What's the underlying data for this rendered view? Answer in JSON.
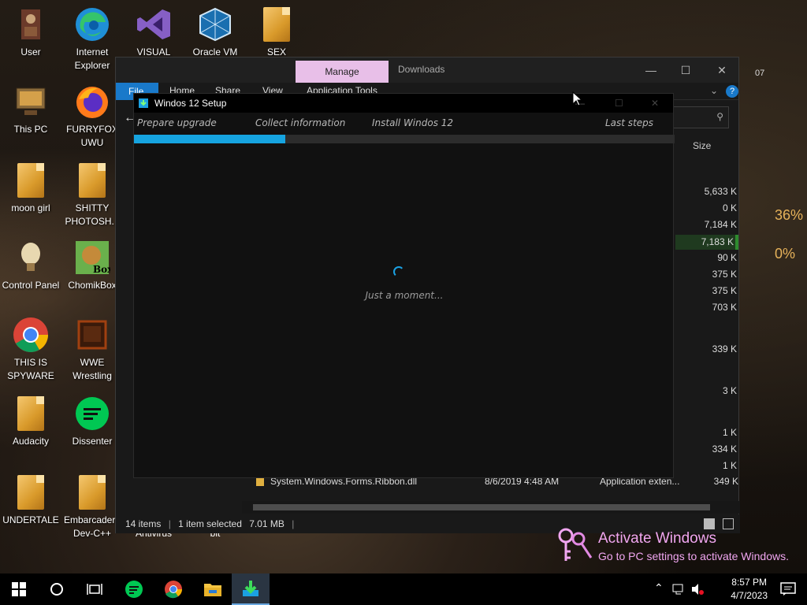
{
  "desktop": {
    "icons": [
      {
        "label": "User",
        "icon": "user-icon"
      },
      {
        "label": "Internet Explorer",
        "icon": "edge-icon"
      },
      {
        "label": "VISUAL",
        "icon": "visual-studio-icon"
      },
      {
        "label": "Oracle VM",
        "icon": "virtualbox-icon"
      },
      {
        "label": "SEX",
        "icon": "file-icon"
      },
      {
        "label": "This PC",
        "icon": "computer-icon"
      },
      {
        "label": "FURRYFOX UWU",
        "icon": "firefox-icon"
      },
      {
        "label": "moon girl",
        "icon": "file-icon"
      },
      {
        "label": "SHITTY PHOTOSH...",
        "icon": "file-icon"
      },
      {
        "label": "Control Panel",
        "icon": "control-panel-icon"
      },
      {
        "label": "ChomikBox",
        "icon": "chomikbox-icon"
      },
      {
        "label": "THIS IS SPYWARE",
        "icon": "chrome-icon"
      },
      {
        "label": "WWE Wrestling",
        "icon": "game-icon"
      },
      {
        "label": "Audacity",
        "icon": "file-icon"
      },
      {
        "label": "Dissenter",
        "icon": "dissenter-icon"
      },
      {
        "label": "UNDERTALE",
        "icon": "file-icon"
      },
      {
        "label": "Embarcadero Dev-C++",
        "icon": "file-icon"
      }
    ],
    "partial_labels": {
      "antivirus": "Antivirus",
      "bit": "bit"
    }
  },
  "explorer": {
    "context_tab": "Manage",
    "title": "Downloads",
    "ribbon": {
      "file": "File",
      "home": "Home",
      "share": "Share",
      "view": "View",
      "app_tools": "Application Tools"
    },
    "column_size": "Size",
    "sizes": [
      "5,633 K",
      "0 K",
      "7,184 K",
      "7,183 K",
      "90 K",
      "375 K",
      "375 K",
      "703 K",
      "339 K",
      "3 K",
      "1 K",
      "334 K",
      "1 K"
    ],
    "visible_row": {
      "name": "System.Windows.Forms.Ribbon.dll",
      "date": "8/6/2019 4:48 AM",
      "type": "Application exten...",
      "size": "349 K"
    },
    "status": {
      "items": "14 items",
      "selected": "1 item selected",
      "size": "7.01 MB"
    },
    "side_number": "07"
  },
  "setup": {
    "title": "Windos 12 Setup",
    "steps": [
      "Prepare upgrade",
      "Collect information",
      "Install Windos 12",
      "Last steps"
    ],
    "progress": 0.28,
    "message": "Just a moment..."
  },
  "overlay": {
    "percent_top": "36%",
    "percent_bottom": "0%"
  },
  "activation": {
    "line1": "Activate Windows",
    "line2": "Go to PC settings to activate Windows."
  },
  "taskbar": {
    "time": "8:57 PM",
    "date": "4/7/2023"
  }
}
